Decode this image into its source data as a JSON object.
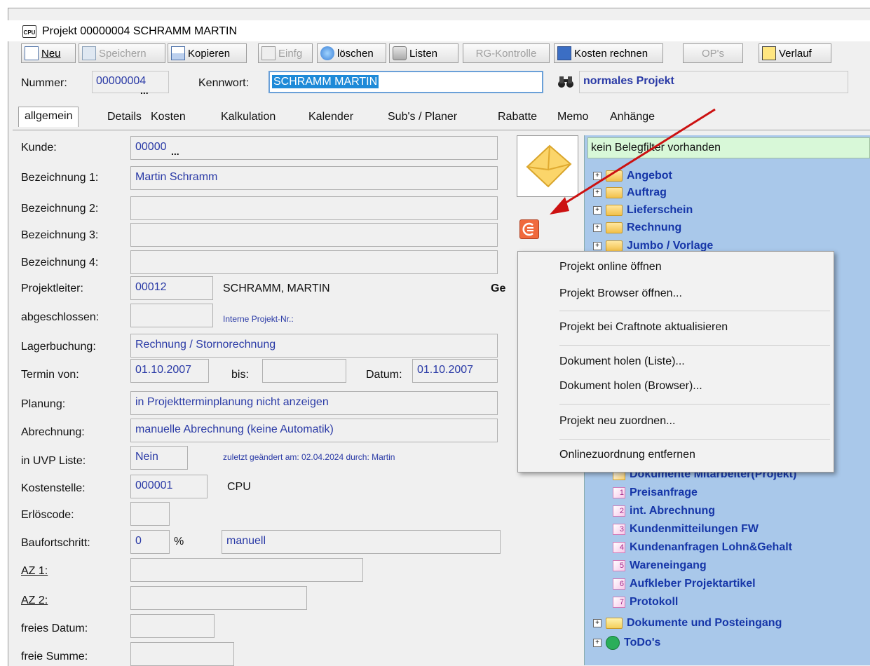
{
  "window": {
    "title": "Projekt 00000004 SCHRAMM MARTIN",
    "app_icon_text": "CPU"
  },
  "toolbar": {
    "new": "Neu",
    "save": "Speichern",
    "copy": "Kopieren",
    "paste": "Einfg",
    "delete": "löschen",
    "lists": "Listen",
    "rg_check": "RG-Kontrolle",
    "calc_costs": "Kosten rechnen",
    "ops": "OP's",
    "history": "Verlauf"
  },
  "header": {
    "number_label": "Nummer:",
    "number_value": "00000004",
    "keyword_label": "Kennwort:",
    "keyword_value": "SCHRAMM MARTIN",
    "project_type": "normales Projekt"
  },
  "tabs": [
    "allgemein",
    "Details",
    "Kosten",
    "Kalkulation",
    "Kalender",
    "Sub's / Planer",
    "Rabatte",
    "Memo",
    "Anhänge"
  ],
  "form": {
    "kunde_label": "Kunde:",
    "kunde_value": "00000",
    "bez1_label": "Bezeichnung 1:",
    "bez1_value": "Martin Schramm",
    "bez2_label": "Bezeichnung 2:",
    "bez3_label": "Bezeichnung 3:",
    "bez4_label": "Bezeichnung 4:",
    "projektleiter_label": "Projektleiter:",
    "projektleiter_code": "00012",
    "projektleiter_name": "SCHRAMM, MARTIN",
    "ge_label": "Ge",
    "abgeschlossen_label": "abgeschlossen:",
    "interne_nr_label": "Interne Projekt-Nr.:",
    "lager_label": "Lagerbuchung:",
    "lager_value": "Rechnung / Stornorechnung",
    "termin_label": "Termin von:",
    "termin_value": "01.10.2007",
    "bis_label": "bis:",
    "datum_label": "Datum:",
    "datum_value": "01.10.2007",
    "planung_label": "Planung:",
    "planung_value": "in Projektterminplanung nicht anzeigen",
    "abrechnung_label": "Abrechnung:",
    "abrechnung_value": "manuelle Abrechnung (keine Automatik)",
    "uvp_label": "in UVP Liste:",
    "uvp_value": "Nein",
    "changed_info": "zuletzt geändert am:  02.04.2024  durch:  Martin",
    "kst_label": "Kostenstelle:",
    "kst_code": "000001",
    "kst_name": "CPU",
    "erloes_label": "Erlöscode:",
    "bau_label": "Baufortschritt:",
    "bau_value": "0",
    "bau_unit": "%",
    "bau_mode": "manuell",
    "az1_label": "AZ 1:",
    "az2_label": "AZ 2:",
    "freies_datum_label": "freies Datum:",
    "freie_summe_label": "freie Summe:"
  },
  "tree": {
    "filter_text": "kein Belegfilter vorhanden",
    "folders": [
      "Angebot",
      "Auftrag",
      "Lieferschein",
      "Rechnung",
      "Jumbo / Vorlage"
    ],
    "docs": [
      {
        "n": "",
        "label": "Dokumente Mitarbeiter(Projekt)"
      },
      {
        "n": "1",
        "label": "Preisanfrage"
      },
      {
        "n": "2",
        "label": "int. Abrechnung"
      },
      {
        "n": "3",
        "label": "Kundenmitteilungen FW"
      },
      {
        "n": "4",
        "label": "Kundenanfragen Lohn&Gehalt"
      },
      {
        "n": "5",
        "label": "Wareneingang"
      },
      {
        "n": "6",
        "label": "Aufkleber Projektartikel"
      },
      {
        "n": "7",
        "label": "Protokoll"
      }
    ],
    "bottom": [
      "Dokumente und Posteingang",
      "ToDo's"
    ]
  },
  "context_menu": {
    "items": [
      "Projekt online öffnen",
      "Projekt Browser öffnen...",
      "Projekt bei Craftnote aktualisieren",
      "Dokument holen (Liste)...",
      "Dokument holen (Browser)...",
      "Projekt neu zuordnen...",
      "Onlinezuordnung entfernen"
    ]
  },
  "colors": {
    "field_text": "#2a3aa6",
    "tree_bg": "#a9c8ea",
    "tree_text": "#1636a8",
    "accent_arrow": "#cc1111",
    "filter_bg": "#d8f8d8"
  }
}
